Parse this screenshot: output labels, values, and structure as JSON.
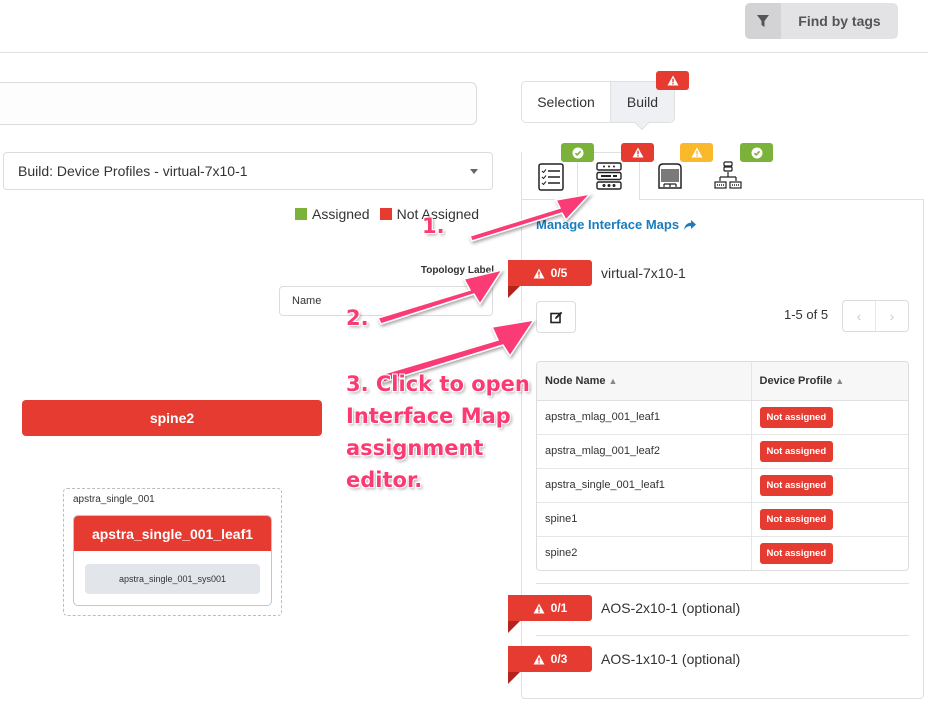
{
  "header": {
    "find_by_tags_label": "Find by tags",
    "find_by_tags_icon": "filter-icon"
  },
  "left": {
    "search_value": "",
    "view_select": "Build: Device Profiles - virtual-7x10-1",
    "legend": [
      {
        "label": "Assigned",
        "color": "#7bb23a"
      },
      {
        "label": "Not Assigned",
        "color": "#e53b30"
      }
    ],
    "topology_label_title": "Topology Label",
    "topology_label_value": "Name",
    "nodes": {
      "spine": "spine2",
      "group_label": "apstra_single_001",
      "leaf": "apstra_single_001_leaf1",
      "system": "apstra_single_001_sys001"
    }
  },
  "right": {
    "mode_tabs": [
      {
        "label": "Selection",
        "active": false
      },
      {
        "label": "Build",
        "active": true,
        "status": "error"
      }
    ],
    "build_tabs": [
      {
        "name": "resources",
        "icon": "list-checks-icon",
        "status": "ok"
      },
      {
        "name": "device-profiles",
        "icon": "server-stack-icon",
        "status": "error",
        "active": true
      },
      {
        "name": "devices",
        "icon": "device-chassis-icon",
        "status": "warning"
      },
      {
        "name": "config",
        "icon": "network-topology-icon",
        "status": "ok"
      }
    ],
    "manage_link": "Manage Interface Maps",
    "groups": [
      {
        "count": "0/5",
        "name": "virtual-7x10-1"
      },
      {
        "count": "0/1",
        "name": "AOS-2x10-1 (optional)"
      },
      {
        "count": "0/3",
        "name": "AOS-1x10-1 (optional)"
      }
    ],
    "pager_text": "1-5 of 5",
    "pager_prev": "‹",
    "pager_next": "›",
    "table": {
      "columns": [
        "Node Name",
        "Device Profile"
      ],
      "rows": [
        {
          "node": "apstra_mlag_001_leaf1",
          "profile": "Not assigned"
        },
        {
          "node": "apstra_mlag_001_leaf2",
          "profile": "Not assigned"
        },
        {
          "node": "apstra_single_001_leaf1",
          "profile": "Not assigned"
        },
        {
          "node": "spine1",
          "profile": "Not assigned"
        },
        {
          "node": "spine2",
          "profile": "Not assigned"
        }
      ]
    }
  },
  "annotations": {
    "step1": "1.",
    "step2": "2.",
    "step3": "3. Click to open Interface Map assignment editor.",
    "color": "#fb3a74"
  },
  "colors": {
    "error": "#e53b30",
    "ok": "#7bb23a",
    "warning": "#f9b92a",
    "link": "#1a7cc1"
  }
}
